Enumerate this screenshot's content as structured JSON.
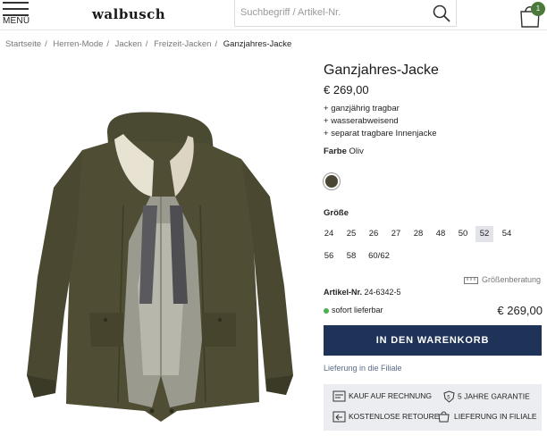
{
  "header": {
    "menu_label": "MENÜ",
    "logo": "walbusch",
    "search_placeholder": "Suchbegriff / Artikel-Nr.",
    "cart_count": "1"
  },
  "breadcrumb": [
    "Startseite",
    "Herren-Mode",
    "Jacken",
    "Freizeit-Jacken",
    "Ganzjahres-Jacke"
  ],
  "product": {
    "title": "Ganzjahres-Jacke",
    "price": "€ 269,00",
    "features": [
      "ganzjährig tragbar",
      "wasserabweisend",
      "separat tragbare Innenjacke"
    ],
    "color_label": "Farbe",
    "color_value": "Oliv",
    "swatch_color": "#4a4634",
    "size_label": "Größe",
    "sizes": [
      "24",
      "25",
      "26",
      "27",
      "28",
      "48",
      "50",
      "52",
      "54",
      "56",
      "58",
      "60/62"
    ],
    "selected_size": "52",
    "size_guide": "Größenberatung",
    "article_label": "Artikel-Nr.",
    "article_number": "24-6342-5",
    "availability": "sofort lieferbar",
    "price_bottom": "€ 269,00",
    "cart_button": "IN DEN WARENKORB",
    "store_link": "Lieferung in die Filiale"
  },
  "benefits": [
    "KAUF AUF RECHNUNG",
    "5 JAHRE GARANTIE",
    "KOSTENLOSE RETOURE",
    "LIEFERUNG IN FILIALE"
  ],
  "colors": {
    "accent": "#1f3359",
    "badge": "#4c7a3a",
    "available": "#4caf50",
    "selected_size_bg": "#e2e4ea"
  }
}
